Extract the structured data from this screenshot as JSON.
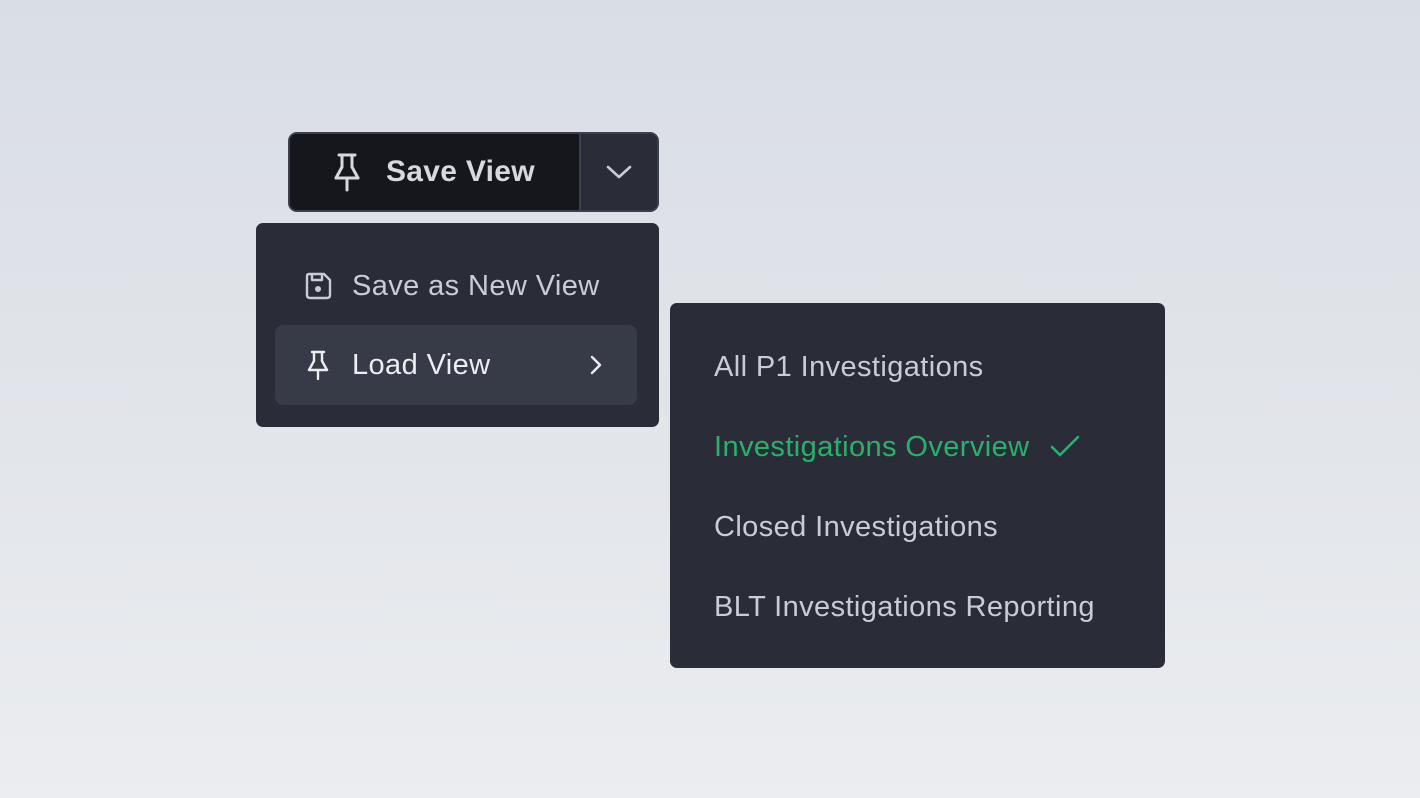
{
  "colors": {
    "background": "#dde1e6",
    "panel": "#2a2d38",
    "button_dark": "#15171d",
    "hover_row": "#373a47",
    "text": "#c9ccd3",
    "selected": "#26b26a"
  },
  "save_button": {
    "label": "Save View",
    "icon": "pin-icon",
    "dropdown_icon": "chevron-down-icon"
  },
  "menu": {
    "items": [
      {
        "label": "Save as New View",
        "icon": "save-disk-icon"
      },
      {
        "label": "Load View",
        "icon": "pin-icon",
        "submenu_icon": "chevron-right-icon",
        "highlighted": true
      }
    ]
  },
  "submenu": {
    "items": [
      {
        "label": "All P1 Investigations",
        "selected": false
      },
      {
        "label": "Investigations Overview",
        "selected": true,
        "icon": "check-icon"
      },
      {
        "label": "Closed Investigations",
        "selected": false
      },
      {
        "label": "BLT Investigations Reporting",
        "selected": false
      }
    ]
  }
}
